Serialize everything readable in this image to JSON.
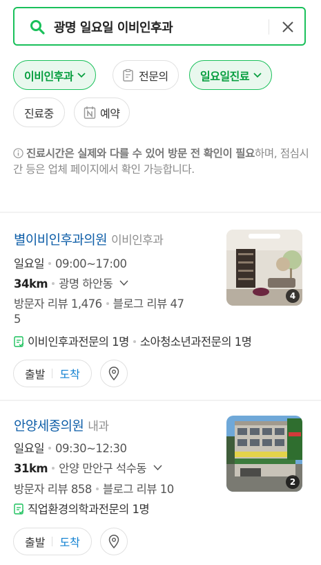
{
  "search": {
    "query": "광명 일요일 이비인후과"
  },
  "filters": [
    {
      "label": "이비인후과",
      "active": true,
      "icon": "chevron-down-icon"
    },
    {
      "label": "전문의",
      "active": false,
      "icon": "clipboard-icon"
    },
    {
      "label": "일요일진료",
      "active": true,
      "icon": "chevron-down-icon"
    },
    {
      "label": "진료중",
      "active": false
    },
    {
      "label": "예약",
      "active": false,
      "icon": "naver-booking-icon"
    }
  ],
  "notice": {
    "bold": "진료시간은 실제와 다를 수 있어 방문 전 확인이 필요",
    "rest": "하며, 점심시간 등은 업체 페이지에서 확인 가능합니다."
  },
  "results": [
    {
      "name": "별이비인후과의원",
      "category": "이비인후과",
      "day": "일요일",
      "hours": "09:00~17:00",
      "distance": "34km",
      "area": "광명 하안동",
      "visitor_reviews": "방문자 리뷰 1,476",
      "blog_reviews_a": "블로그 리뷰 47",
      "blog_reviews_b": "5",
      "specialists": [
        "이비인후과전문의 1명",
        "소아청소년과전문의 1명"
      ],
      "photo_count": "4",
      "start_label": "출발",
      "arrive_label": "도착"
    },
    {
      "name": "안양세종의원",
      "category": "내과",
      "day": "일요일",
      "hours": "09:30~12:30",
      "distance": "31km",
      "area": "안양 만안구 석수동",
      "visitor_reviews": "방문자 리뷰 858",
      "blog_reviews": "블로그 리뷰 10",
      "specialists": [
        "직업환경의학과전문의 1명"
      ],
      "photo_count": "2",
      "start_label": "출발",
      "arrive_label": "도착"
    }
  ],
  "colors": {
    "brand_green": "#19c05a",
    "link_blue": "#0e5ea8",
    "arrive_blue": "#0e7fd0"
  }
}
